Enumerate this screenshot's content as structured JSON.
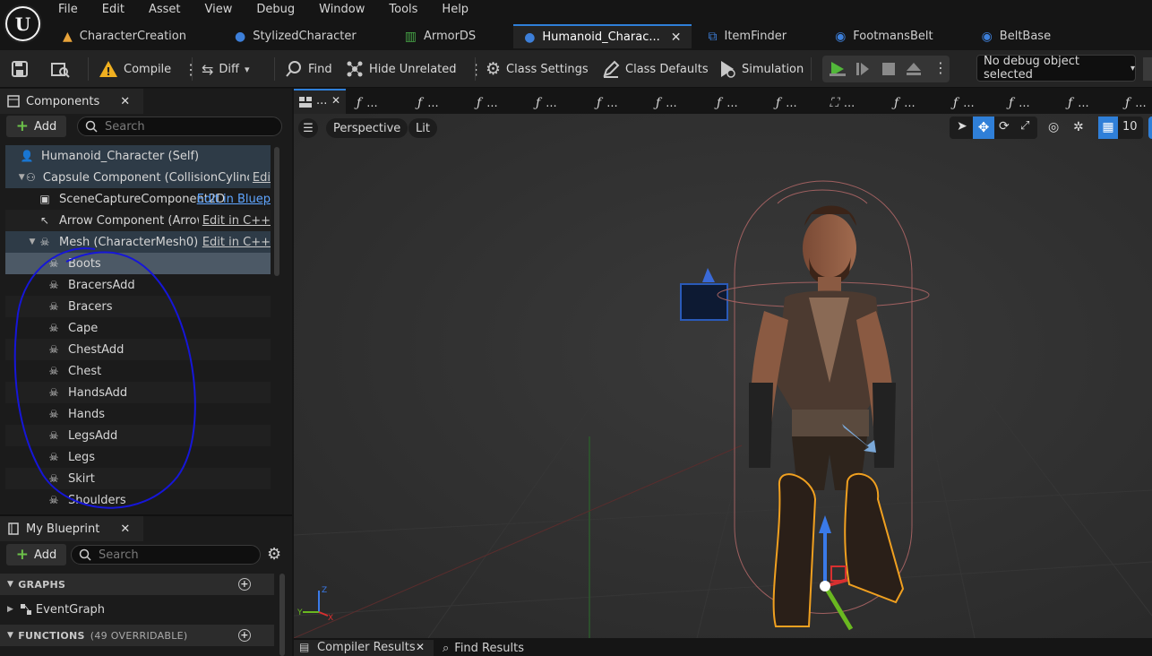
{
  "menu": [
    "File",
    "Edit",
    "Asset",
    "View",
    "Debug",
    "Window",
    "Tools",
    "Help"
  ],
  "doc_tabs": [
    {
      "label": "CharacterCreation",
      "icon": "warning-icon",
      "color": "#e8a33a"
    },
    {
      "label": "StylizedCharacter",
      "icon": "character-icon",
      "color": "#3d7fd9"
    },
    {
      "label": "ArmorDS",
      "icon": "datatable-icon",
      "color": "#48a848"
    },
    {
      "label": "Humanoid_Charac...",
      "icon": "character-icon",
      "color": "#3d7fd9",
      "active": true
    },
    {
      "label": "ItemFinder",
      "icon": "blueprint-icon",
      "color": "#3d7fd9"
    },
    {
      "label": "FootmansBelt",
      "icon": "actor-icon",
      "color": "#3d7fd9"
    },
    {
      "label": "BeltBase",
      "icon": "actor-icon",
      "color": "#3d7fd9"
    }
  ],
  "toolbar": {
    "compile": "Compile",
    "diff": "Diff",
    "find": "Find",
    "hide_unrelated": "Hide Unrelated",
    "class_settings": "Class Settings",
    "class_defaults": "Class Defaults",
    "simulation": "Simulation",
    "debug_object": "No debug object selected"
  },
  "components_panel": {
    "title": "Components",
    "add_label": "Add",
    "search_placeholder": "Search",
    "tree": [
      {
        "label": "Humanoid_Character (Self)",
        "indent": 0,
        "icon": "self-icon",
        "style": "hdr"
      },
      {
        "label": "Capsule Component (CollisionCylinder)",
        "indent": 1,
        "icon": "capsule-icon",
        "expander": true,
        "edit": "Edi",
        "edit_style": "cpp",
        "style": "hdr"
      },
      {
        "label": "SceneCaptureComponent2D",
        "indent": 2,
        "icon": "capture-icon",
        "edit": "Edit in Bluep",
        "edit_style": "bp"
      },
      {
        "label": "Arrow Component (Arrow)",
        "indent": 2,
        "icon": "arrow-icon",
        "edit": "Edit in C++",
        "edit_style": "cpp",
        "style": "alt"
      },
      {
        "label": "Mesh (CharacterMesh0)",
        "indent": 2,
        "icon": "skeletal-mesh-icon",
        "expander": true,
        "edit": "Edit in C++",
        "edit_style": "cpp",
        "style": "hdr"
      },
      {
        "label": "Boots",
        "indent": 3,
        "icon": "skeletal-mesh-icon",
        "style": "sel"
      },
      {
        "label": "BracersAdd",
        "indent": 3,
        "icon": "skeletal-mesh-icon"
      },
      {
        "label": "Bracers",
        "indent": 3,
        "icon": "skeletal-mesh-icon",
        "style": "alt"
      },
      {
        "label": "Cape",
        "indent": 3,
        "icon": "skeletal-mesh-icon"
      },
      {
        "label": "ChestAdd",
        "indent": 3,
        "icon": "skeletal-mesh-icon",
        "style": "alt"
      },
      {
        "label": "Chest",
        "indent": 3,
        "icon": "skeletal-mesh-icon"
      },
      {
        "label": "HandsAdd",
        "indent": 3,
        "icon": "skeletal-mesh-icon",
        "style": "alt"
      },
      {
        "label": "Hands",
        "indent": 3,
        "icon": "skeletal-mesh-icon"
      },
      {
        "label": "LegsAdd",
        "indent": 3,
        "icon": "skeletal-mesh-icon",
        "style": "alt"
      },
      {
        "label": "Legs",
        "indent": 3,
        "icon": "skeletal-mesh-icon"
      },
      {
        "label": "Skirt",
        "indent": 3,
        "icon": "skeletal-mesh-icon",
        "style": "alt"
      },
      {
        "label": "Shoulders",
        "indent": 3,
        "icon": "skeletal-mesh-icon"
      }
    ]
  },
  "my_blueprint": {
    "title": "My Blueprint",
    "add_label": "Add",
    "search_placeholder": "Search",
    "graphs_header": "GRAPHS",
    "event_graph": "EventGraph",
    "functions_header": "FUNCTIONS",
    "functions_count": "(49 OVERRIDABLE)"
  },
  "graph_tabs": {
    "first_label": "...",
    "function_tab_label": "...",
    "function_tab_count": 14
  },
  "viewport": {
    "perspective": "Perspective",
    "lit": "Lit",
    "grid_snap": "10"
  },
  "bottom_tabs": {
    "compiler_results": "Compiler Results",
    "find_results": "Find Results"
  },
  "colors": {
    "accent": "#2f7fd8",
    "annotation_circle": "#1616d8",
    "selection_outline": "#f0a020",
    "add_plus": "#6cc24a"
  }
}
